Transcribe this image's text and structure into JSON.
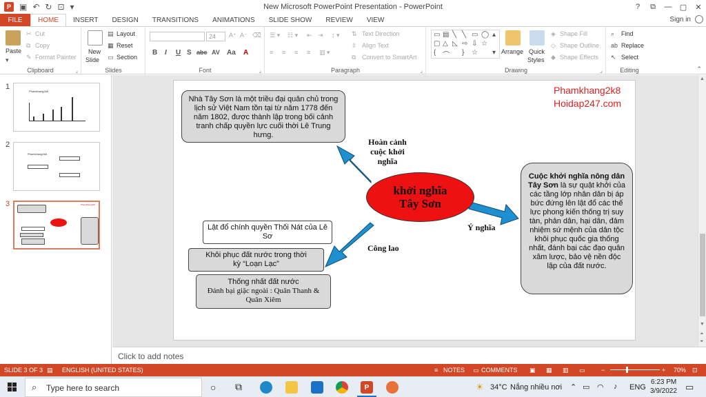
{
  "window": {
    "title": "New Microsoft PowerPoint Presentation - PowerPoint",
    "app_logo": "P",
    "controls": [
      "?",
      "⧉",
      "—",
      "▢",
      "✕"
    ]
  },
  "tabs": [
    "FILE",
    "HOME",
    "INSERT",
    "DESIGN",
    "TRANSITIONS",
    "ANIMATIONS",
    "SLIDE SHOW",
    "REVIEW",
    "VIEW"
  ],
  "active_tab": "HOME",
  "signin": "Sign in",
  "ribbon": {
    "clipboard": {
      "label": "Clipboard",
      "paste": "Paste",
      "cut": "Cut",
      "copy": "Copy",
      "format_painter": "Format Painter"
    },
    "slides": {
      "label": "Slides",
      "new_slide": "New",
      "new_slide2": "Slide",
      "layout": "Layout",
      "reset": "Reset",
      "section": "Section"
    },
    "font": {
      "label": "Font",
      "size": "24",
      "buttons": [
        "B",
        "I",
        "U",
        "S",
        "abc",
        "AV",
        "Aa",
        "A"
      ]
    },
    "paragraph": {
      "label": "Paragraph",
      "text_direction": "Text Direction",
      "align_text": "Align Text",
      "smartart": "Convert to SmartArt"
    },
    "drawing": {
      "label": "Drawing",
      "arrange": "Arrange",
      "quick_styles": "Quick",
      "quick_styles2": "Styles",
      "shape_fill": "Shape Fill",
      "shape_outline": "Shape Outline",
      "shape_effects": "Shape Effects"
    },
    "editing": {
      "label": "Editing",
      "find": "Find",
      "replace": "Replace",
      "select": "Select"
    }
  },
  "thumbnails": [
    {
      "num": "1",
      "title": "Phamkhang2k8"
    },
    {
      "num": "2",
      "title": "Phamkhang2k8"
    },
    {
      "num": "3",
      "title": "Phamkhang2k8"
    }
  ],
  "slide": {
    "box_top": "Nhà Tây Sơn là một triều đại quân chủ trong lịch sử Việt Nam tồn tại từ năm 1778 đến năm 1802, được thành lập trong bối cảnh tranh chấp quyền lực cuối thời Lê Trung hưng.",
    "center_line1": "khởi nghĩa",
    "center_line2": "Tây Sơn",
    "label_hoancanh": "Hoàn cảnh cuộc khởi nghĩa",
    "label_ynghia": "Ý nghĩa",
    "label_conglao": "Công lao",
    "watermark1": "Phamkhang2k8",
    "watermark2": "Hoidap247.com",
    "right_title": "Cuộc khởi nghĩa nông dân Tây Sơn",
    "right_body": " là sự quật khởi của các tầng lớp nhân dân bị áp bức đứng lên lật đổ các thế lực phong kiến thống trị suy tàn, phản dân, hại dân, đảm nhiệm sứ mệnh của dân tộc khôi phục quốc gia thống nhất, đánh bại các đạo quân xâm lược, bảo vệ nền độc lập của đất nước.",
    "box_latdo": "Lật đổ chính quyền Thối Nát của Lê Sơ",
    "box_khoiphuc": "Khôi phục đất nước trong thời kỳ “Loạn Lạc”",
    "box_thongnhat": "Thống nhất đất nước",
    "box_danhbai": "Đánh bại giặc ngoài : Quân Thanh & Quân Xiêm"
  },
  "notes_placeholder": "Click to add notes",
  "status": {
    "slide": "SLIDE 3 OF 3",
    "language": "ENGLISH (UNITED STATES)",
    "notes": "NOTES",
    "comments": "COMMENTS",
    "zoom": "70%",
    "zoom_level_pct": 70
  },
  "taskbar": {
    "search_placeholder": "Type here to search",
    "weather": "34°C",
    "weather_desc": "Nắng nhiều nơi",
    "lang": "ENG",
    "time": "6:23 PM",
    "date": "3/9/2022"
  },
  "colors": {
    "accent": "#d24726",
    "ellipse": "#ee1111",
    "arrow": "#1e90d0",
    "watermark": "#e02020"
  }
}
